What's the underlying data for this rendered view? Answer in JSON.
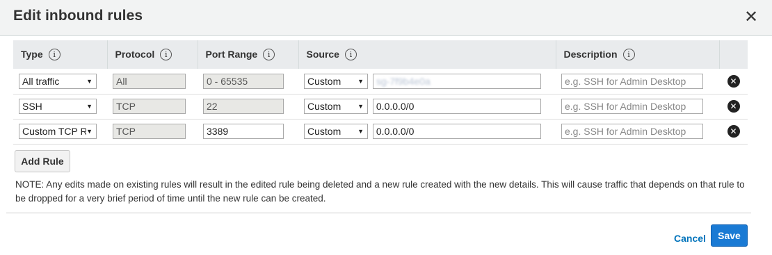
{
  "modal": {
    "title": "Edit inbound rules",
    "close_glyph": "✕"
  },
  "table": {
    "headers": {
      "type": "Type",
      "protocol": "Protocol",
      "port_range": "Port Range",
      "source": "Source",
      "description": "Description"
    },
    "info_glyph": "i",
    "rows": [
      {
        "type": "All traffic",
        "protocol": "All",
        "port_range": "0 - 65535",
        "source_type": "Custom",
        "source_value": "sg-7f9b4e0a",
        "source_redacted": true,
        "description_placeholder": "e.g. SSH for Admin Desktop",
        "port_editable": false
      },
      {
        "type": "SSH",
        "protocol": "TCP",
        "port_range": "22",
        "source_type": "Custom",
        "source_value": "0.0.0.0/0",
        "source_redacted": false,
        "description_placeholder": "e.g. SSH for Admin Desktop",
        "port_editable": false
      },
      {
        "type": "Custom TCP Rule",
        "protocol": "TCP",
        "port_range": "3389",
        "source_type": "Custom",
        "source_value": "0.0.0.0/0",
        "source_redacted": false,
        "description_placeholder": "e.g. SSH for Admin Desktop",
        "port_editable": true
      }
    ],
    "delete_glyph": "✕",
    "caret_glyph": "▼"
  },
  "actions": {
    "add_rule": "Add Rule",
    "cancel": "Cancel",
    "save": "Save"
  },
  "note": "NOTE: Any edits made on existing rules will result in the edited rule being deleted and a new rule created with the new details. This will cause traffic that depends on that rule to be dropped for a very brief period of time until the new rule can be created.",
  "colors": {
    "header_bg": "#f2f3f3",
    "table_header_bg": "#e9ebed",
    "readonly_field_bg": "#e8e8e5",
    "primary_button": "#1a7ad4",
    "link": "#0073bb"
  }
}
